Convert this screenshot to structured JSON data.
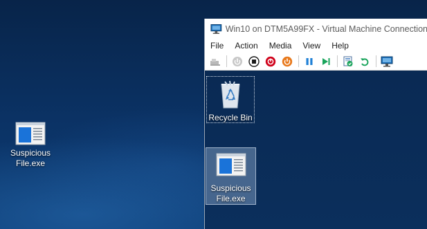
{
  "host_desktop": {
    "icons": [
      {
        "label_line1": "Suspicious",
        "label_line2": "File.exe",
        "icon": "exe-file-icon"
      }
    ]
  },
  "vm_window": {
    "title": "Win10 on DTM5A99FX - Virtual Machine Connection",
    "menu": [
      "File",
      "Action",
      "Media",
      "View",
      "Help"
    ],
    "toolbar": [
      "ctrl-alt-del-icon",
      "start-icon",
      "turn-off-icon",
      "shut-down-icon",
      "save-icon",
      "pause-icon",
      "reset-icon",
      "checkpoint-icon",
      "revert-icon",
      "enhanced-session-icon"
    ],
    "colors": {
      "stop_red": "#d0021b",
      "power_orange": "#e8791c",
      "pause_blue": "#1e7fd6",
      "play_green": "#19a45b"
    }
  },
  "guest_desktop": {
    "icons": [
      {
        "label": "Recycle Bin",
        "icon": "recycle-bin-icon",
        "selected": false,
        "focused": true
      },
      {
        "label_line1": "Suspicious",
        "label_line2": "File.exe",
        "icon": "exe-file-icon",
        "selected": true
      }
    ]
  }
}
